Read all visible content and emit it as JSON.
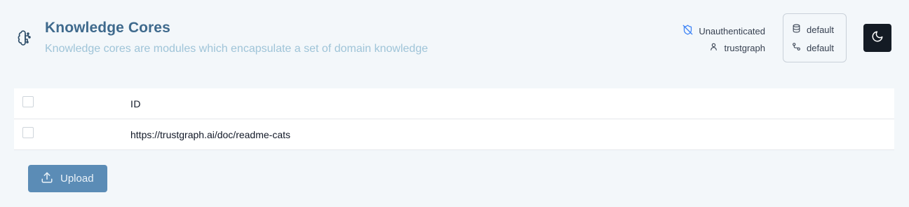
{
  "header": {
    "title": "Knowledge Cores",
    "subtitle": "Knowledge cores are modules which encapsulate a set of domain knowledge"
  },
  "auth": {
    "status": "Unauthenticated",
    "user": "trustgraph"
  },
  "context": {
    "collection": "default",
    "flow": "default"
  },
  "table": {
    "columns": [
      "ID"
    ],
    "rows": [
      {
        "id": "https://trustgraph.ai/doc/readme-cats"
      }
    ]
  },
  "actions": {
    "upload_label": "Upload"
  },
  "colors": {
    "accent": "#5b8cb6",
    "title": "#3f6a8d",
    "subtitle": "#9fc4d8",
    "background": "#f3f7fa",
    "theme_button": "#141b24"
  },
  "icons": {
    "header": "brain-icon",
    "auth_status": "shield-off-icon",
    "user": "user-icon",
    "collection": "database-icon",
    "flow": "workflow-icon",
    "theme": "moon-icon",
    "upload": "upload-icon"
  }
}
